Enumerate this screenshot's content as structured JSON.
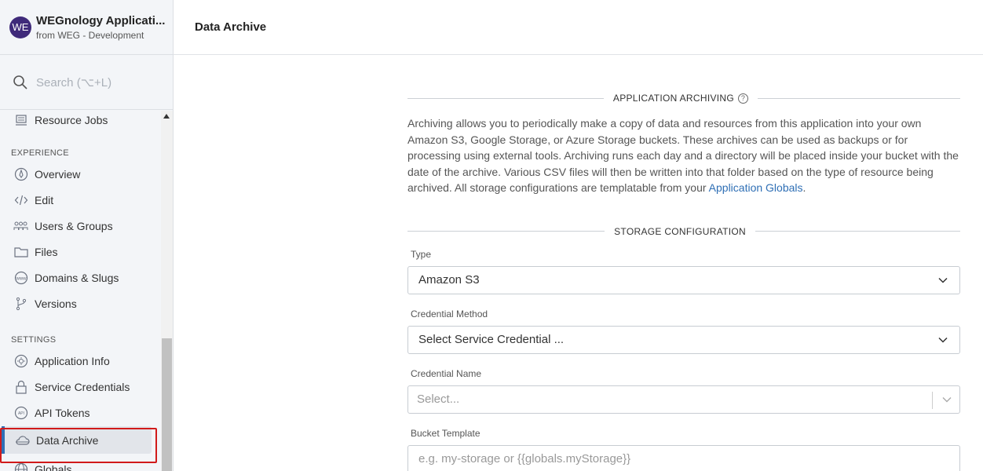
{
  "app": {
    "avatar": "WE",
    "name": "WEGnology Applicati...",
    "subtitle": "from WEG - Development"
  },
  "search": {
    "placeholder": "Search (⌥+L)"
  },
  "sidebar": {
    "top_item": "Resource Jobs",
    "experience_heading": "EXPERIENCE",
    "experience_items": [
      "Overview",
      "Edit",
      "Users & Groups",
      "Files",
      "Domains & Slugs",
      "Versions"
    ],
    "settings_heading": "SETTINGS",
    "settings_items": [
      "Application Info",
      "Service Credentials",
      "API Tokens",
      "Data Archive",
      "Globals"
    ],
    "active_item": "Data Archive"
  },
  "page": {
    "title": "Data Archive"
  },
  "archiving": {
    "heading": "APPLICATION ARCHIVING",
    "description": "Archiving allows you to periodically make a copy of data and resources from this application into your own Amazon S3, Google Storage, or Azure Storage buckets. These archives can be used as backups or for processing using external tools. Archiving runs each day and a directory will be placed inside your bucket with the date of the archive. Various CSV files will then be written into that folder based on the type of resource being archived. All storage configurations are templatable from your ",
    "link_text": "Application Globals",
    "suffix": "."
  },
  "storage": {
    "heading": "STORAGE CONFIGURATION",
    "type_label": "Type",
    "type_value": "Amazon S3",
    "credential_method_label": "Credential Method",
    "credential_method_value": "Select Service Credential ...",
    "credential_name_label": "Credential Name",
    "credential_name_placeholder": "Select...",
    "bucket_label": "Bucket Template",
    "bucket_placeholder": "e.g. my-storage or {{globals.myStorage}}"
  },
  "colors": {
    "accent": "#2f6fb5",
    "highlight": "#d11a1a",
    "avatar": "#3f2a7a"
  }
}
